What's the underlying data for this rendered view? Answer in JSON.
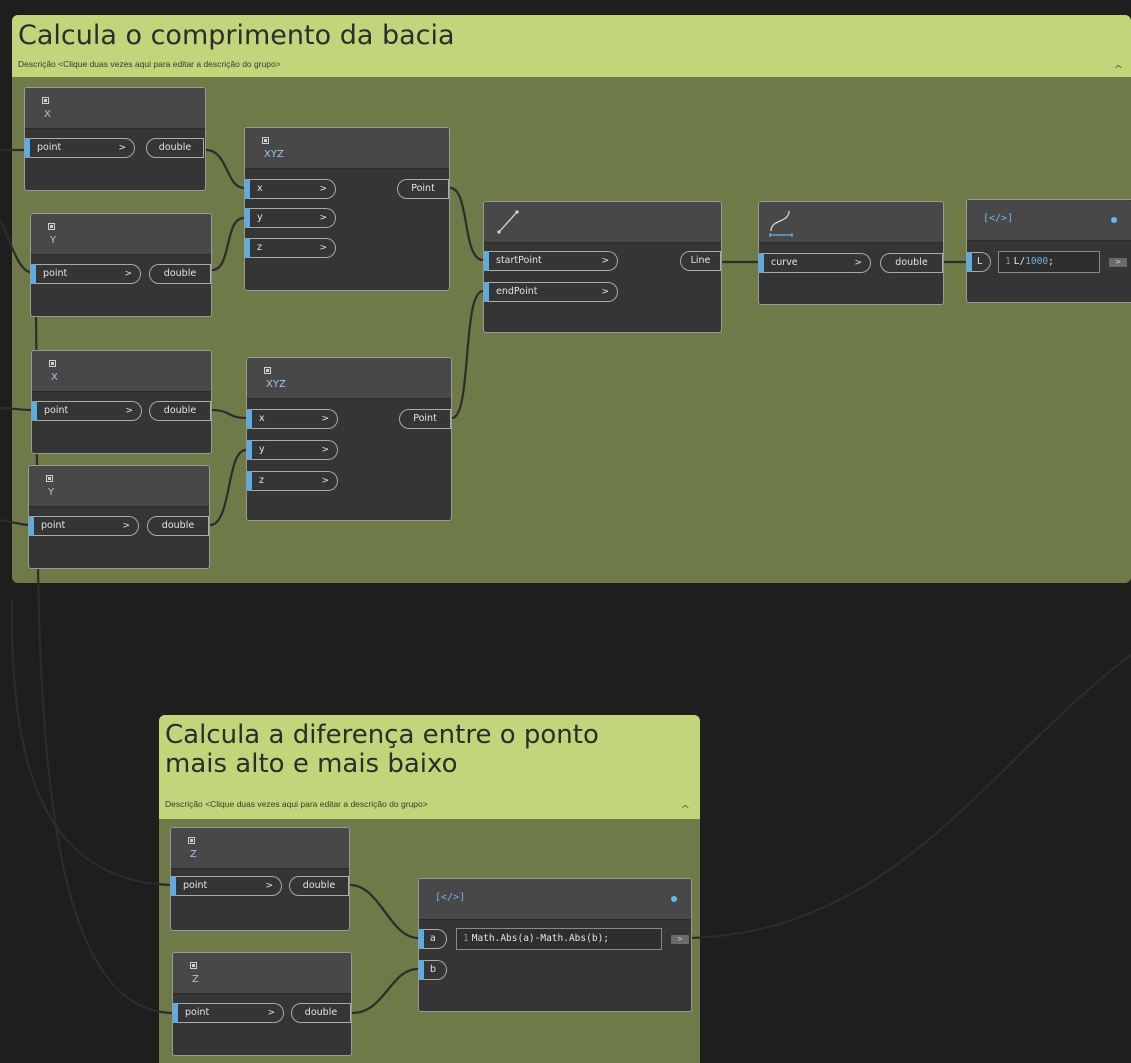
{
  "groups": {
    "top": {
      "title": "Calcula o comprimento da bacia",
      "description": "Descrição <Clique duas vezes aqui para editar a descrição do grupo>"
    },
    "bottom": {
      "title": "Calcula a diferença entre o ponto\nmais alto e mais baixo",
      "description": "Descrição <Clique duas vezes aqui para editar a descrição do grupo>"
    }
  },
  "nodes": {
    "x1": {
      "title": "X",
      "in": "point",
      "out": "double"
    },
    "y1": {
      "title": "Y",
      "in": "point",
      "out": "double"
    },
    "x2": {
      "title": "X",
      "in": "point",
      "out": "double"
    },
    "y2": {
      "title": "Y",
      "in": "point",
      "out": "double"
    },
    "xyz1": {
      "title": "XYZ",
      "inputs": [
        "x",
        "y",
        "z"
      ],
      "out": "Point"
    },
    "xyz2": {
      "title": "XYZ",
      "inputs": [
        "x",
        "y",
        "z"
      ],
      "out": "Point"
    },
    "line": {
      "icon": "line-by-points-icon",
      "inputs": [
        "startPoint",
        "endPoint"
      ],
      "out": "Line"
    },
    "length": {
      "icon": "curve-length-icon",
      "in": "curve",
      "out": "double"
    },
    "code1": {
      "icon_text": "[</>]",
      "input": "L",
      "line_no": "1",
      "code_var": "L/",
      "code_num": "1000",
      "code_end": ";",
      "out_chip": ">"
    },
    "z1": {
      "title": "Z",
      "in": "point",
      "out": "double"
    },
    "z2": {
      "title": "Z",
      "in": "point",
      "out": "double"
    },
    "code2": {
      "icon_text": "[</>]",
      "inputs": [
        "a",
        "b"
      ],
      "line_no": "1",
      "code": "Math.Abs(a)-Math.Abs(b);",
      "out_chip": ">"
    }
  },
  "colors": {
    "canvas": "#1e1e1e",
    "group_header": "#c2d57b",
    "group_body": "#6f7a49",
    "node_body": "#353535",
    "port_accent": "#5aaee6",
    "wire": "#2e2e2e"
  }
}
